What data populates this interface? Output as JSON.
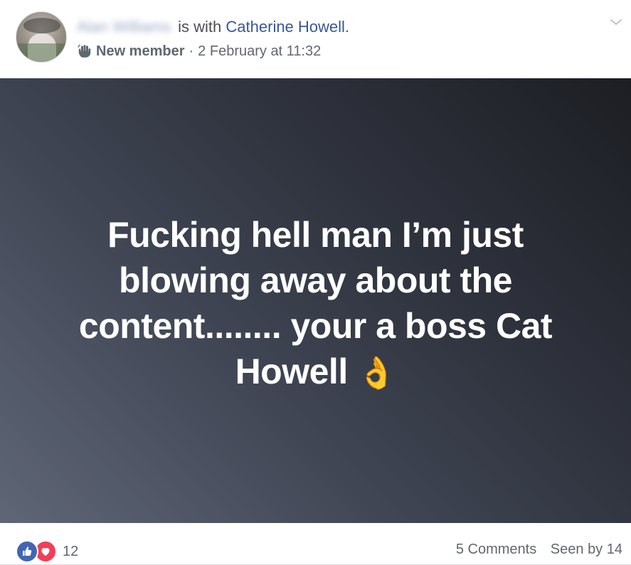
{
  "header": {
    "author_name_blurred": "Alan Williams",
    "with_text": "is with",
    "tagged_name": "Catherine Howell.",
    "badge_label": "New member",
    "separator": "·",
    "timestamp": "2 February at 11:32",
    "badge_icon": "wave-hand-icon",
    "menu_icon": "chevron-down-icon"
  },
  "post": {
    "text": "Fucking hell man I’m just blowing away about the content........ your a boss Cat Howell",
    "emoji": "👌",
    "background_gradient": [
      "#5f6676",
      "#30343f",
      "#1c1e23"
    ]
  },
  "footer": {
    "reaction_icons": [
      "like-icon",
      "love-icon"
    ],
    "reaction_count": "12",
    "comments_label": "5 Comments",
    "seen_label": "Seen by 14"
  },
  "colors": {
    "link": "#365899",
    "like": "#4267b2",
    "love": "#f33e58",
    "meta_text": "#606770"
  }
}
